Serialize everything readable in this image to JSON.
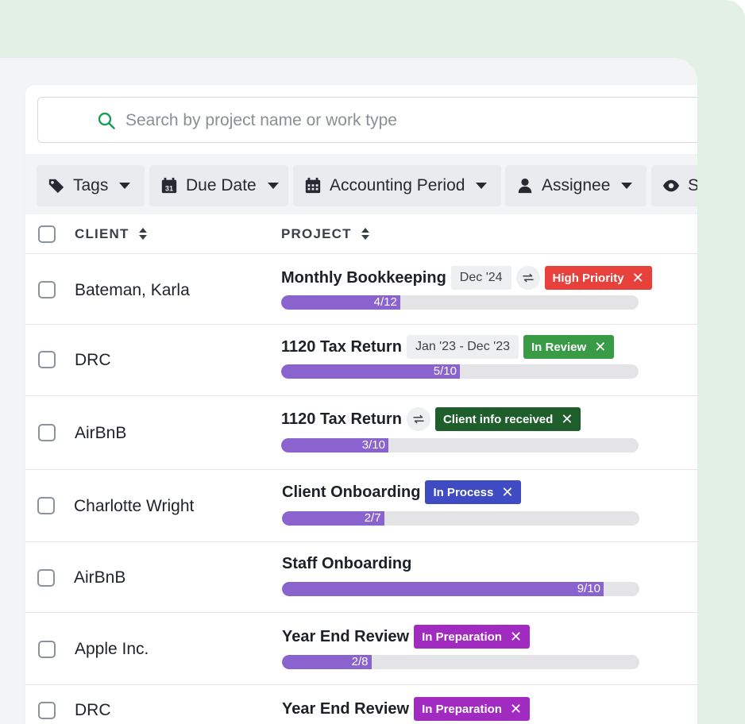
{
  "search": {
    "placeholder": "Search by project name or work type"
  },
  "filters": [
    {
      "label": "Tags",
      "icon": "tag-icon"
    },
    {
      "label": "Due Date",
      "icon": "calendar-31-icon"
    },
    {
      "label": "Accounting Period",
      "icon": "calendar-grid-icon"
    },
    {
      "label": "Assignee",
      "icon": "person-icon"
    },
    {
      "label": "S",
      "icon": "eye-icon"
    }
  ],
  "table": {
    "columns": {
      "client": "CLIENT",
      "project": "PROJECT"
    },
    "rows": [
      {
        "client": "Bateman, Karla",
        "project": "Monthly Bookkeeping",
        "date": "Dec '24",
        "recurring": true,
        "status": "High Priority",
        "status_color": "#e8413c",
        "progress_label": "4/12",
        "progress": 0.333
      },
      {
        "client": "DRC",
        "project": "1120 Tax Return",
        "date": "Jan '23 - Dec '23",
        "recurring": false,
        "status": "In Review",
        "status_color": "#3a9b47",
        "progress_label": "5/10",
        "progress": 0.5
      },
      {
        "client": "AirBnB",
        "project": "1120 Tax Return",
        "date": "",
        "recurring": true,
        "status": "Client info received",
        "status_color": "#1e5e2a",
        "progress_label": "3/10",
        "progress": 0.3
      },
      {
        "client": "Charlotte Wright",
        "project": "Client Onboarding",
        "date": "",
        "recurring": false,
        "status": "In Process",
        "status_color": "#3e4bc2",
        "progress_label": "2/7",
        "progress": 0.2857
      },
      {
        "client": "AirBnB",
        "project": "Staff Onboarding",
        "date": "",
        "recurring": false,
        "status": "",
        "status_color": "",
        "progress_label": "9/10",
        "progress": 0.9
      },
      {
        "client": "Apple Inc.",
        "project": "Year End Review",
        "date": "",
        "recurring": false,
        "status": "In Preparation",
        "status_color": "#a12bc0",
        "progress_label": "2/8",
        "progress": 0.25
      },
      {
        "client": "DRC",
        "project": "Year End Review",
        "date": "",
        "recurring": false,
        "status": "In Preparation",
        "status_color": "#a12bc0",
        "progress_label": "",
        "progress": null
      }
    ]
  },
  "colors": {
    "accent_progress": "#8a63cf",
    "search_icon": "#1a9c5b"
  }
}
